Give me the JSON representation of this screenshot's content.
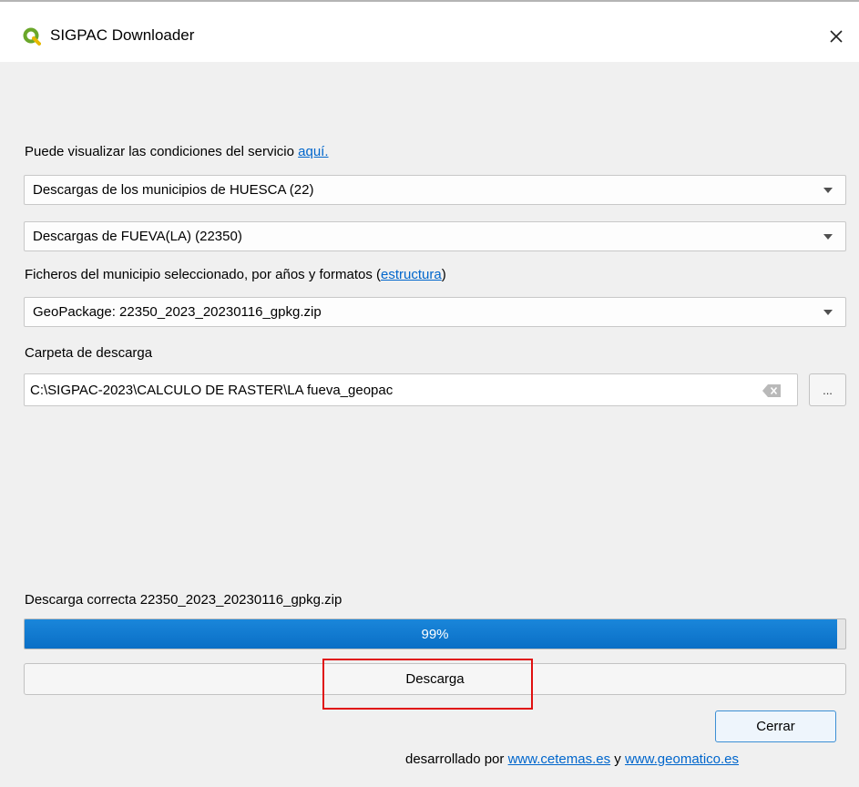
{
  "window": {
    "title": "SIGPAC Downloader",
    "app_icon": "qgis-q-icon",
    "close_icon": "close-icon"
  },
  "terms": {
    "text": "Puede visualizar las condiciones del servicio ",
    "link": "aquí."
  },
  "province_select": {
    "value": "Descargas de los municipios de HUESCA (22)"
  },
  "municipality_select": {
    "value": "Descargas de FUEVA(LA) (22350)"
  },
  "files": {
    "label": "Ficheros del municipio seleccionado, por años y formatos (",
    "link": "estructura",
    "label_end": ")",
    "select_value": "GeoPackage: 22350_2023_20230116_gpkg.zip"
  },
  "folder": {
    "label": "Carpeta de descarga",
    "value": "C:\\SIGPAC-2023\\CALCULO DE RASTER\\LA fueva_geopac",
    "browse_label": "..."
  },
  "status": {
    "text": "Descarga correcta 22350_2023_20230116_gpkg.zip"
  },
  "progress": {
    "value": 0.99,
    "label": "99%"
  },
  "buttons": {
    "download": "Descarga",
    "close": "Cerrar"
  },
  "footer": {
    "prefix": "desarrollado por ",
    "link1": "www.cetemas.es",
    "middle": " y ",
    "link2": "www.geomatico.es"
  },
  "colors": {
    "accent": "#0a6fc6",
    "link": "#0066cc",
    "highlight": "#e01010"
  }
}
